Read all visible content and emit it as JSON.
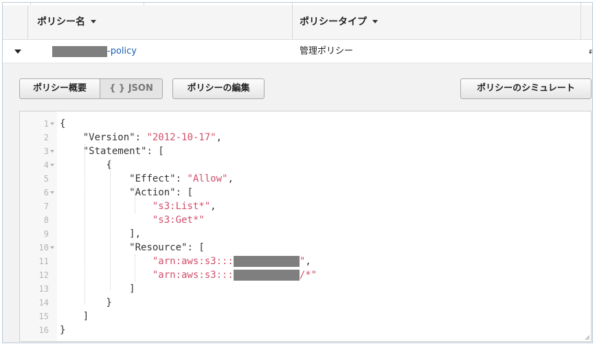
{
  "table": {
    "headers": {
      "policy_name": "ポリシー名",
      "policy_type": "ポリシータイプ"
    },
    "row": {
      "name_suffix": "-policy",
      "type": "管理ポリシー",
      "edge_glyph": "⇄"
    }
  },
  "detail": {
    "buttons": {
      "summary": "ポリシー概要",
      "json": "{ } JSON",
      "edit": "ポリシーの編集",
      "simulate": "ポリシーのシミュレート"
    }
  },
  "editor": {
    "line_numbers": [
      "1",
      "2",
      "3",
      "4",
      "5",
      "6",
      "7",
      "8",
      "9",
      "10",
      "11",
      "12",
      "13",
      "14",
      "15",
      "16"
    ],
    "lines": [
      {
        "indent": "",
        "parts": [
          {
            "t": "{",
            "c": "key"
          }
        ]
      },
      {
        "indent": "    ",
        "parts": [
          {
            "t": "\"Version\"",
            "c": "key"
          },
          {
            "t": ": ",
            "c": "key"
          },
          {
            "t": "\"2012-10-17\"",
            "c": "str"
          },
          {
            "t": ",",
            "c": "key"
          }
        ]
      },
      {
        "indent": "    ",
        "parts": [
          {
            "t": "\"Statement\"",
            "c": "key"
          },
          {
            "t": ": [",
            "c": "key"
          }
        ]
      },
      {
        "indent": "        ",
        "parts": [
          {
            "t": "{",
            "c": "key"
          }
        ]
      },
      {
        "indent": "            ",
        "parts": [
          {
            "t": "\"Effect\"",
            "c": "key"
          },
          {
            "t": ": ",
            "c": "key"
          },
          {
            "t": "\"Allow\"",
            "c": "str"
          },
          {
            "t": ",",
            "c": "key"
          }
        ]
      },
      {
        "indent": "            ",
        "parts": [
          {
            "t": "\"Action\"",
            "c": "key"
          },
          {
            "t": ": [",
            "c": "key"
          }
        ]
      },
      {
        "indent": "                ",
        "parts": [
          {
            "t": "\"s3:List*\"",
            "c": "str"
          },
          {
            "t": ",",
            "c": "key"
          }
        ]
      },
      {
        "indent": "                ",
        "parts": [
          {
            "t": "\"s3:Get*\"",
            "c": "str"
          }
        ]
      },
      {
        "indent": "            ",
        "parts": [
          {
            "t": "],",
            "c": "key"
          }
        ]
      },
      {
        "indent": "            ",
        "parts": [
          {
            "t": "\"Resource\"",
            "c": "key"
          },
          {
            "t": ": [",
            "c": "key"
          }
        ]
      },
      {
        "indent": "                ",
        "parts": [
          {
            "t": "\"arn:aws:s3:::",
            "c": "str"
          },
          {
            "t": "REDACT",
            "c": "redact"
          },
          {
            "t": "\"",
            "c": "str"
          },
          {
            "t": ",",
            "c": "key"
          }
        ]
      },
      {
        "indent": "                ",
        "parts": [
          {
            "t": "\"arn:aws:s3:::",
            "c": "str"
          },
          {
            "t": "REDACT",
            "c": "redact"
          },
          {
            "t": "/*\"",
            "c": "str"
          }
        ]
      },
      {
        "indent": "            ",
        "parts": [
          {
            "t": "]",
            "c": "key"
          }
        ]
      },
      {
        "indent": "        ",
        "parts": [
          {
            "t": "}",
            "c": "key"
          }
        ]
      },
      {
        "indent": "    ",
        "parts": [
          {
            "t": "]",
            "c": "key"
          }
        ]
      },
      {
        "indent": "",
        "parts": [
          {
            "t": "}",
            "c": "key"
          }
        ]
      }
    ],
    "fold_lines": [
      1,
      3,
      4,
      6,
      10
    ]
  }
}
